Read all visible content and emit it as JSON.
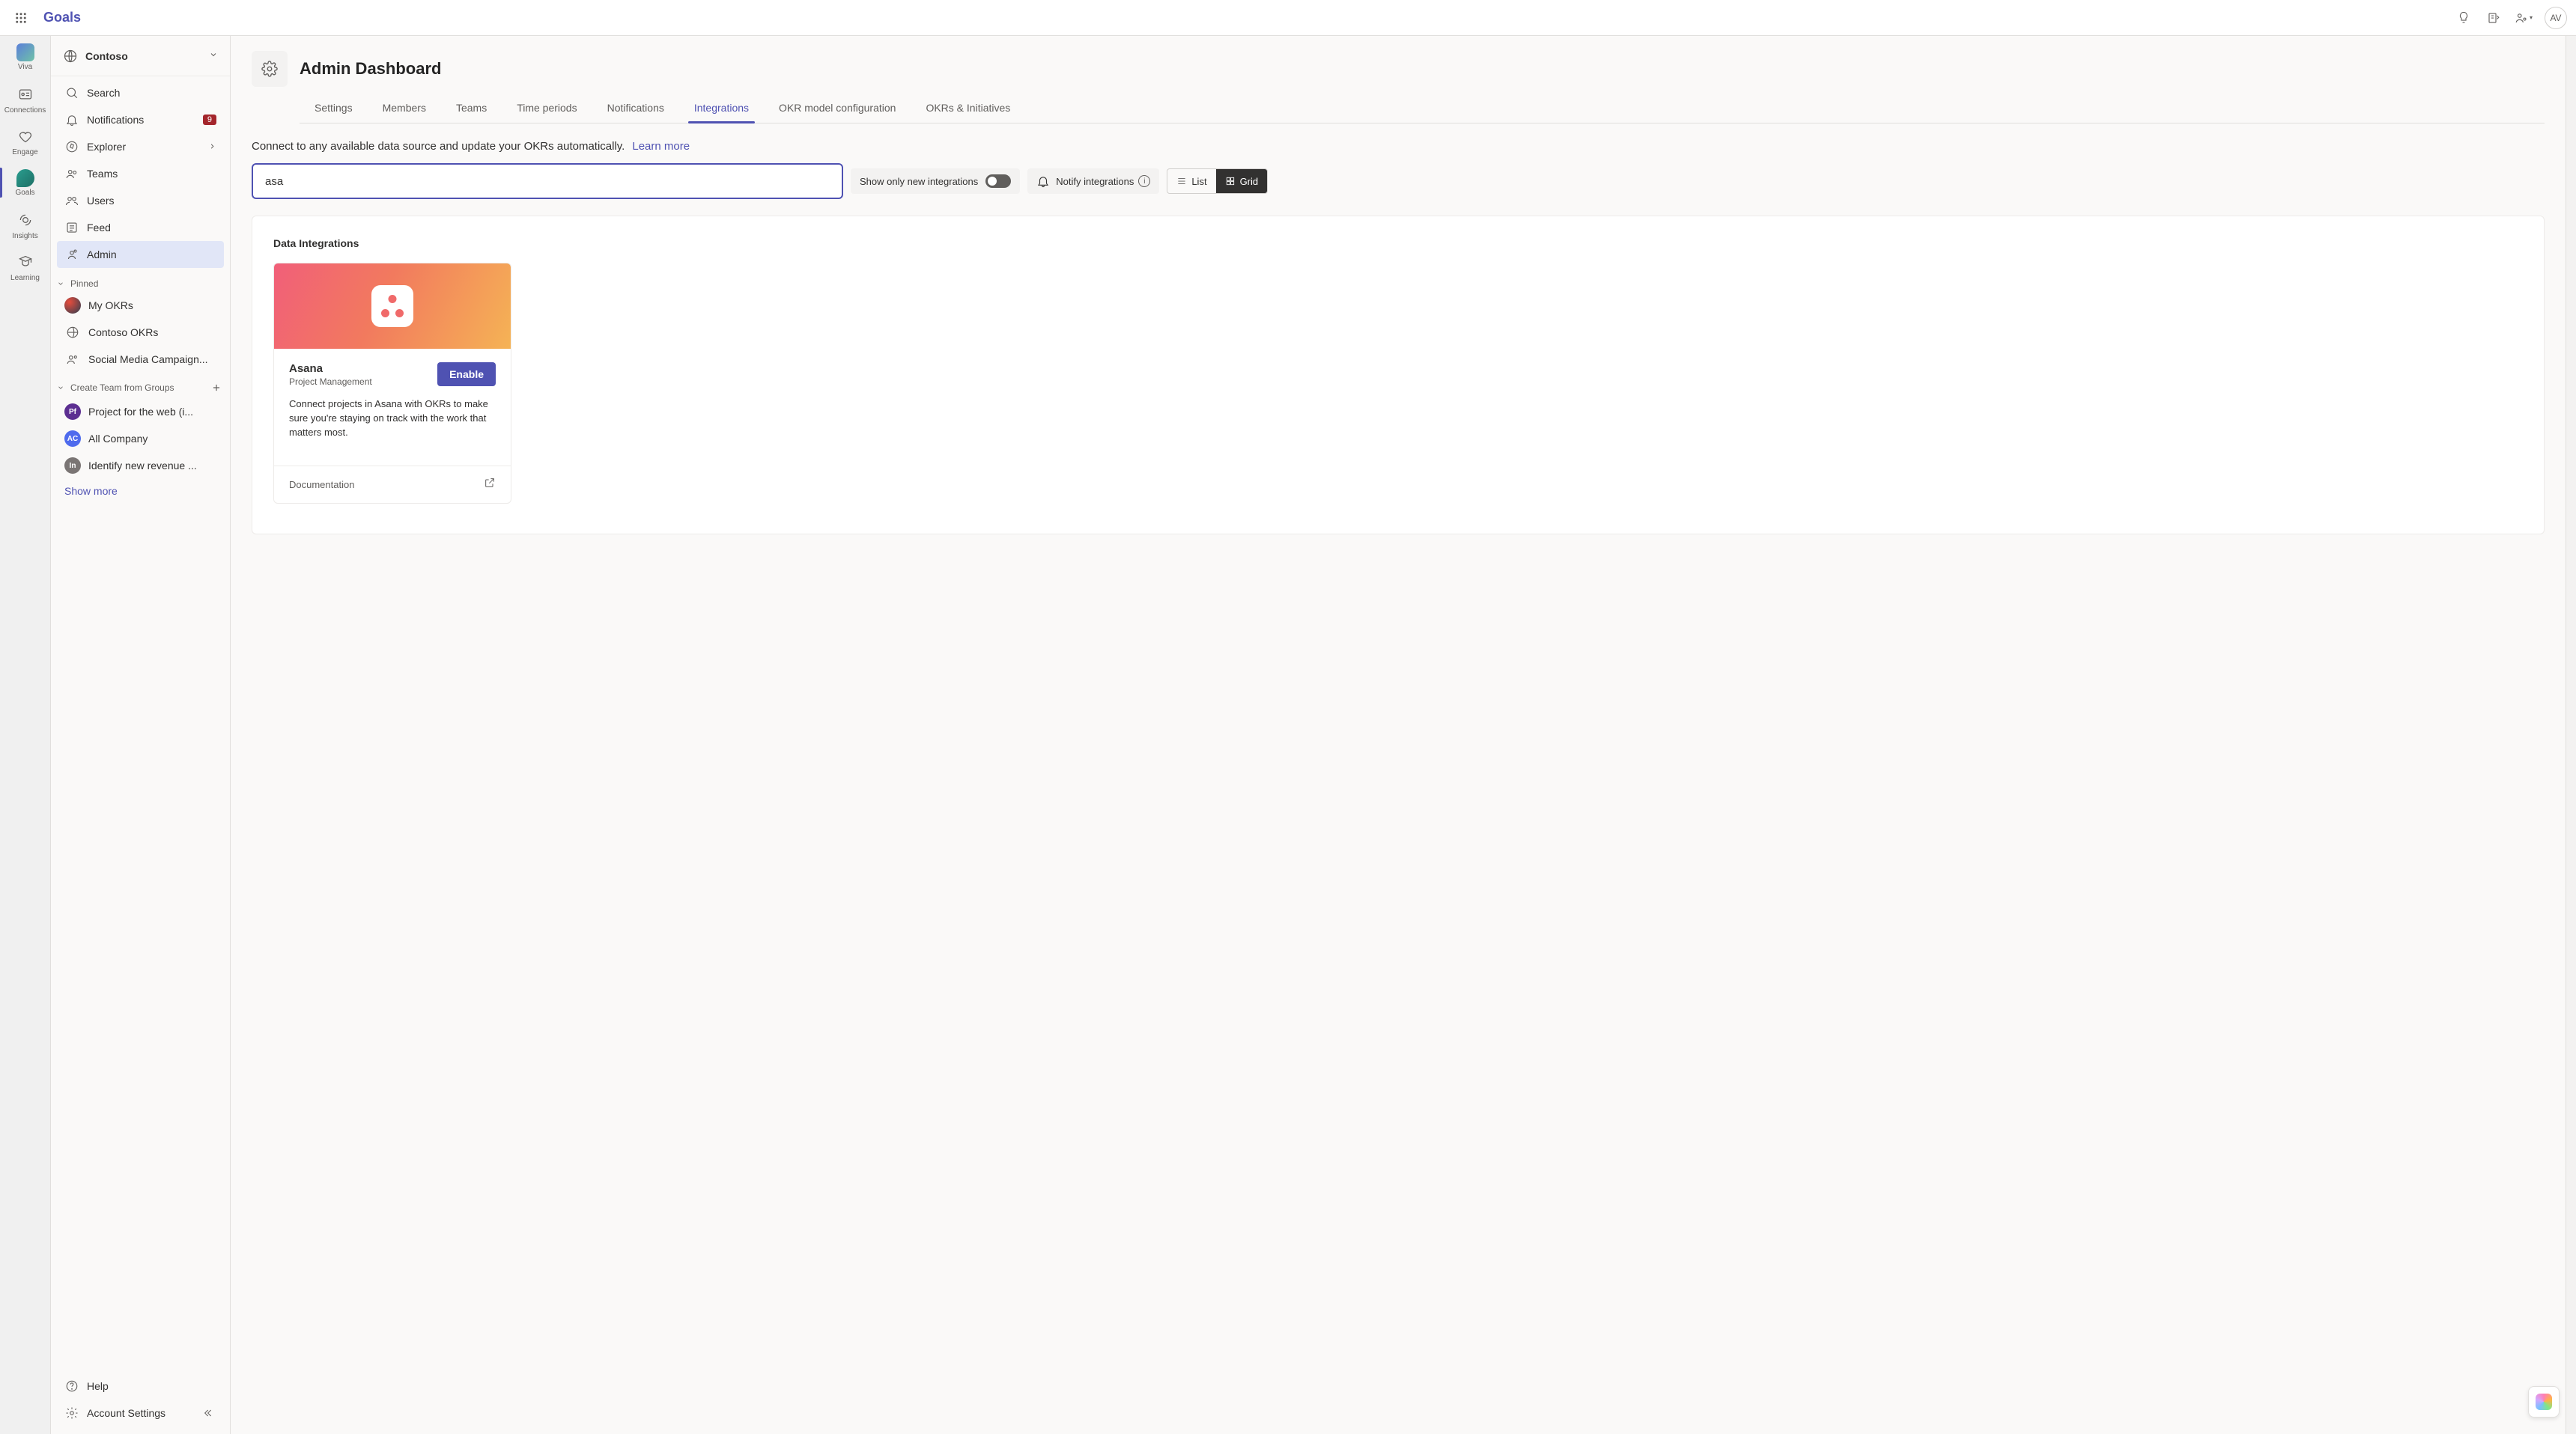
{
  "app_title": "Goals",
  "header": {
    "avatar_initials": "AV"
  },
  "rail": [
    {
      "id": "viva",
      "label": "Viva"
    },
    {
      "id": "connections",
      "label": "Connections"
    },
    {
      "id": "engage",
      "label": "Engage"
    },
    {
      "id": "goals",
      "label": "Goals"
    },
    {
      "id": "insights",
      "label": "Insights"
    },
    {
      "id": "learning",
      "label": "Learning"
    }
  ],
  "org": {
    "name": "Contoso"
  },
  "nav": {
    "items": [
      {
        "id": "search",
        "label": "Search"
      },
      {
        "id": "notifications",
        "label": "Notifications",
        "badge": "9"
      },
      {
        "id": "explorer",
        "label": "Explorer"
      },
      {
        "id": "teams",
        "label": "Teams"
      },
      {
        "id": "users",
        "label": "Users"
      },
      {
        "id": "feed",
        "label": "Feed"
      },
      {
        "id": "admin",
        "label": "Admin"
      }
    ],
    "pinned_header": "Pinned",
    "pinned": [
      {
        "id": "my-okrs",
        "label": "My OKRs"
      },
      {
        "id": "contoso-okrs",
        "label": "Contoso OKRs"
      },
      {
        "id": "social",
        "label": "Social Media Campaign..."
      }
    ],
    "groups_header": "Create Team from Groups",
    "groups": [
      {
        "id": "pf",
        "initials": "Pf",
        "label": "Project for the web (i..."
      },
      {
        "id": "ac",
        "initials": "AC",
        "label": "All Company"
      },
      {
        "id": "in",
        "initials": "In",
        "label": "Identify new revenue ..."
      }
    ],
    "show_more": "Show more",
    "help": "Help",
    "account_settings": "Account Settings"
  },
  "page": {
    "title": "Admin Dashboard",
    "tabs": [
      "Settings",
      "Members",
      "Teams",
      "Time periods",
      "Notifications",
      "Integrations",
      "OKR model configuration",
      "OKRs & Initiatives"
    ],
    "active_tab_index": 5,
    "subtext": "Connect to any available data source and update your OKRs automatically.",
    "learn_more": "Learn more",
    "search_value": "asa",
    "show_new_label": "Show only new integrations",
    "notify_label": "Notify integrations",
    "view_list": "List",
    "view_grid": "Grid"
  },
  "integrations": {
    "section_title": "Data Integrations",
    "cards": [
      {
        "name": "Asana",
        "category": "Project Management",
        "enable_label": "Enable",
        "description": "Connect projects in Asana with OKRs to make sure you're staying on track with the work that matters most.",
        "doc_label": "Documentation"
      }
    ]
  }
}
